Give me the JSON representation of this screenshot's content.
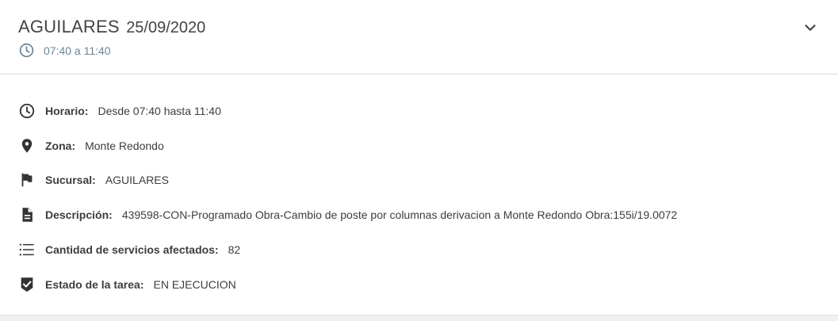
{
  "header": {
    "title": "AGUILARES",
    "date": "25/09/2020",
    "time_range": "07:40 a 11:40",
    "clock_icon": "clock-icon",
    "toggle_icon": "chevron-down-icon"
  },
  "details": [
    {
      "icon": "clock-icon",
      "label": "Horario:",
      "value": "Desde 07:40 hasta 11:40"
    },
    {
      "icon": "location-pin-icon",
      "label": "Zona:",
      "value": "Monte Redondo"
    },
    {
      "icon": "flag-icon",
      "label": "Sucursal:",
      "value": "AGUILARES"
    },
    {
      "icon": "document-icon",
      "label": "Descripción:",
      "value": "439598-CON-Programado Obra-Cambio de poste por columnas derivacion a Monte Redondo Obra:155i/19.0072"
    },
    {
      "icon": "list-icon",
      "label": "Cantidad de servicios afectados:",
      "value": "82"
    },
    {
      "icon": "verified-shield-icon",
      "label": "Estado de la tarea:",
      "value": "EN EJECUCION"
    }
  ],
  "colors": {
    "text": "#3d3d3d",
    "subtitle": "#6b8596",
    "divider": "#dcdcdc"
  }
}
